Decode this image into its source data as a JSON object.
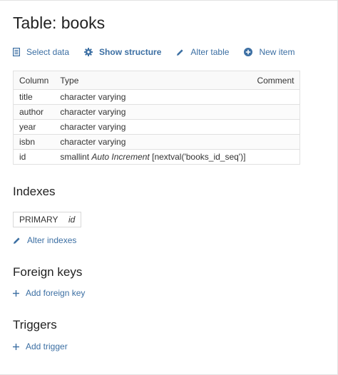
{
  "page_title": "Table: books",
  "links": {
    "select_data": "Select data",
    "show_structure": "Show structure",
    "alter_table": "Alter table",
    "new_item": "New item"
  },
  "structure": {
    "headers": {
      "column": "Column",
      "type": "Type",
      "comment": "Comment"
    },
    "rows": [
      {
        "column": "title",
        "type": "character varying",
        "extra": "",
        "default": "",
        "comment": ""
      },
      {
        "column": "author",
        "type": "character varying",
        "extra": "",
        "default": "",
        "comment": ""
      },
      {
        "column": "year",
        "type": "character varying",
        "extra": "",
        "default": "",
        "comment": ""
      },
      {
        "column": "isbn",
        "type": "character varying",
        "extra": "",
        "default": "",
        "comment": ""
      },
      {
        "column": "id",
        "type": "smallint",
        "extra": "Auto Increment",
        "default": "[nextval('books_id_seq')]",
        "comment": ""
      }
    ]
  },
  "indexes": {
    "heading": "Indexes",
    "items": [
      {
        "type": "PRIMARY",
        "columns": "id"
      }
    ],
    "alter_label": "Alter indexes"
  },
  "foreign_keys": {
    "heading": "Foreign keys",
    "add_label": "Add foreign key"
  },
  "triggers": {
    "heading": "Triggers",
    "add_label": "Add trigger"
  },
  "colors": {
    "link": "#3c6fa3",
    "text": "#333333",
    "border": "#e1e1e1"
  }
}
